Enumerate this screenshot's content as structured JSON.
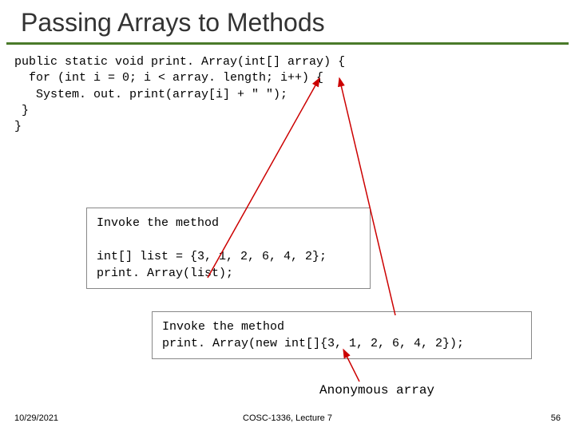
{
  "title": "Passing Arrays to Methods",
  "code": {
    "line1": "public static void print. Array(int[] array) {",
    "line2": "  for (int i = 0; i < array. length; i++) {",
    "line3": "   System. out. print(array[i] + \" \");",
    "line4": " }",
    "line5": "}"
  },
  "box1": {
    "line1": "Invoke the method",
    "line2": "",
    "line3": "int[] list = {3, 1, 2, 6, 4, 2};",
    "line4": "print. Array(list);"
  },
  "box2": {
    "line1": "Invoke the method",
    "line2": "print. Array(new int[]{3, 1, 2, 6, 4, 2});"
  },
  "annotation": "Anonymous array",
  "footer": {
    "date": "10/29/2021",
    "center": "COSC-1336, Lecture 7",
    "page": "56"
  }
}
